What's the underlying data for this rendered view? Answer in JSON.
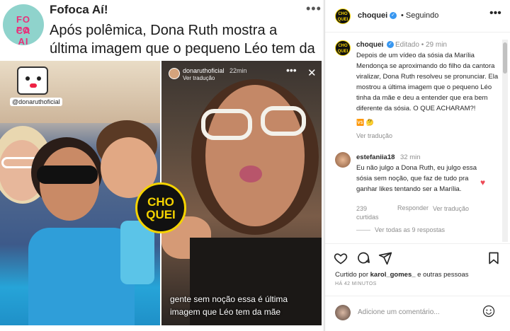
{
  "left": {
    "logo_line1": "FO FO",
    "logo_line2": "CA AI",
    "account_name": "Fofoca Aí!",
    "more": "•••",
    "headline": "Após polêmica, Dona Ruth mostra a última imagem que o pequeno Léo tem da mãe.",
    "photo_tag": "@donaruthoficial",
    "badge_text": "CHO QUEI",
    "story": {
      "user": "donaruthoficial",
      "time": "22min",
      "translate": "Ver tradução",
      "more": "•••",
      "close": "✕",
      "caption": "gente sem noção essa é última imagem que Léo tem da mãe"
    }
  },
  "post": {
    "header": {
      "avatar_text": "CHO QUEI",
      "username": "choquei",
      "follow": "• Seguindo",
      "more": "•••"
    },
    "caption": {
      "username": "choquei",
      "edited": "Editado • 29 min",
      "text": "Depois de um vídeo da sósia da Marília Mendonça se aproximando do filho da cantora viralizar, Dona Ruth resolveu se pronunciar. Ela mostrou a última imagem que o pequeno Léo tinha da mãe e deu a entender que era bem diferente da sósia. O QUE ACHARAM?!",
      "emoji": "🆚 🤔",
      "translate": "Ver tradução"
    },
    "comment": {
      "username": "estefaniia18",
      "time": "32 min",
      "text": "Eu não julgo a Dona Ruth, eu julgo essa sósia sem noção, que faz de tudo pra ganhar likes tentando ser a Marília.",
      "likes": "239 curtidas",
      "reply": "Responder",
      "see_translation": "Ver tradução",
      "view_replies": "Ver todas as 9 respostas"
    },
    "liked_by_prefix": "Curtido por ",
    "liked_by_user": "karol_gomes_",
    "liked_by_suffix": " e outras pessoas",
    "time_ago": "HÁ 42 MINUTOS",
    "add_comment_placeholder": "Adicione um comentário..."
  },
  "colors": {
    "verified": "#3897f0",
    "heart": "#ed4956",
    "brand_yellow": "#f5d300"
  },
  "icons": [
    "heart-icon",
    "comment-icon",
    "share-icon",
    "bookmark-icon",
    "emoji-icon",
    "verified-icon",
    "close-icon"
  ]
}
